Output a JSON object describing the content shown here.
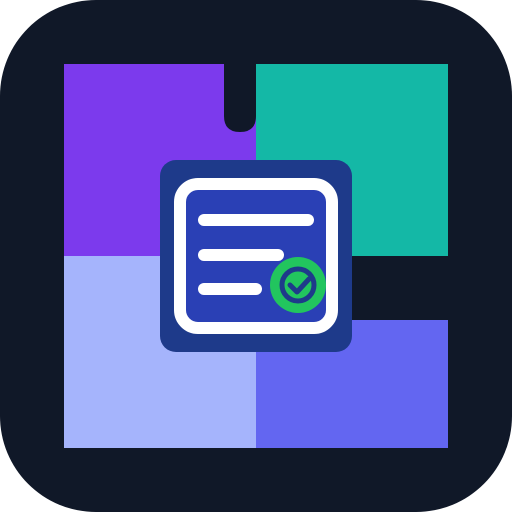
{
  "icon": {
    "name": "form-checklist-app-icon",
    "colors": {
      "background": "#101828",
      "tile_top_left": "#7C3AED",
      "tile_top_right": "#14B8A6",
      "tile_bottom_left": "#A5B4FC",
      "tile_bottom_right": "#6366F1",
      "card_frame": "#1E3A8A",
      "card_fill": "#2A40B5",
      "card_border": "#FFFFFF",
      "text_lines": "#FFFFFF",
      "check_badge": "#22C55E",
      "check_mark": "#1E3A8A"
    },
    "symbols": [
      "document-lines-icon",
      "check-badge-icon"
    ]
  }
}
